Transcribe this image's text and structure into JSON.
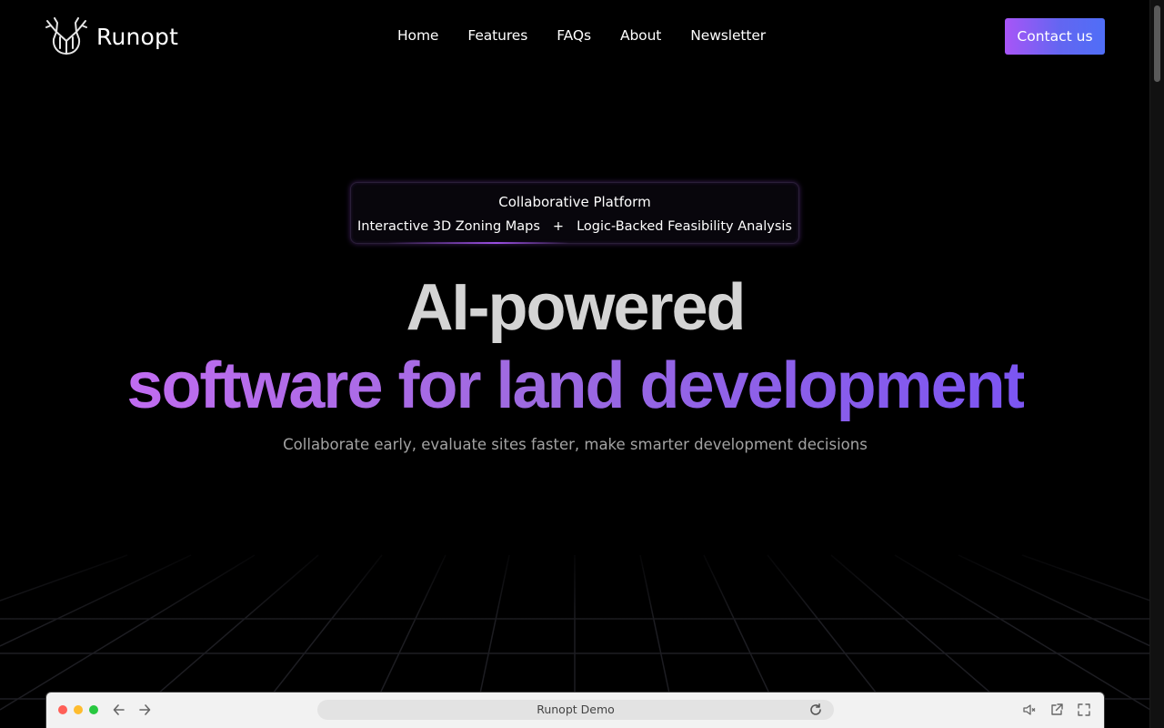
{
  "brand": {
    "name": "Runopt"
  },
  "nav": {
    "items": [
      {
        "label": "Home"
      },
      {
        "label": "Features"
      },
      {
        "label": "FAQs"
      },
      {
        "label": "About"
      },
      {
        "label": "Newsletter"
      }
    ],
    "cta_label": "Contact us"
  },
  "badge": {
    "title": "Collaborative Platform",
    "left": "Interactive 3D Zoning Maps",
    "separator": "+",
    "right": "Logic-Backed Feasibility Analysis"
  },
  "hero": {
    "line1": "AI-powered",
    "line2": "software for land development",
    "subtitle": "Collaborate early, evaluate sites faster, make smarter development decisions"
  },
  "demo_browser": {
    "address": "Runopt Demo"
  },
  "colors": {
    "background": "#000000",
    "accent_start": "#a855f7",
    "accent_end": "#4f6ef7",
    "hero_gray": "#d4d4d4",
    "subtitle_gray": "#a3a3a3"
  },
  "icons": {
    "logo": "deer-antler-logo-icon",
    "back": "arrow-left-icon",
    "forward": "arrow-right-icon",
    "reload": "reload-icon",
    "mute": "speaker-muted-icon",
    "open": "external-link-icon",
    "fullscreen": "fullscreen-icon"
  }
}
